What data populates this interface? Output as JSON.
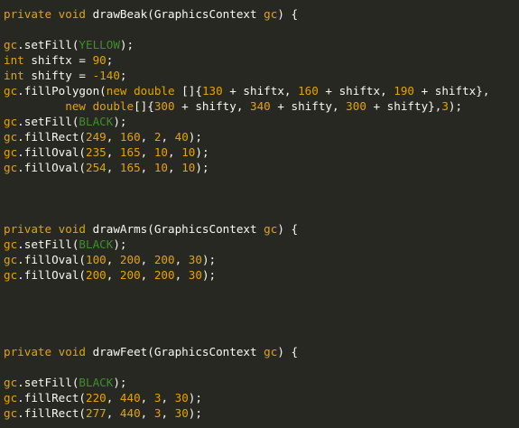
{
  "code": {
    "lines": [
      {
        "tokens": [
          [
            "kw",
            "private"
          ],
          [
            "op",
            " "
          ],
          [
            "kw",
            "void"
          ],
          [
            "op",
            " drawBeak(GraphicsContext "
          ],
          [
            "pm",
            "gc"
          ],
          [
            "op",
            ") {"
          ]
        ]
      },
      {
        "tokens": []
      },
      {
        "tokens": [
          [
            "obj",
            "gc"
          ],
          [
            "op",
            ".setFill("
          ],
          [
            "col",
            "YELLOW"
          ],
          [
            "op",
            ");"
          ]
        ]
      },
      {
        "tokens": [
          [
            "kw",
            "int"
          ],
          [
            "op",
            " shiftx = "
          ],
          [
            "num",
            "90"
          ],
          [
            "op",
            ";"
          ]
        ]
      },
      {
        "tokens": [
          [
            "kw",
            "int"
          ],
          [
            "op",
            " shifty = "
          ],
          [
            "num",
            "-140"
          ],
          [
            "op",
            ";"
          ]
        ]
      },
      {
        "tokens": [
          [
            "obj",
            "gc"
          ],
          [
            "op",
            ".fillPolygon("
          ],
          [
            "kw",
            "new"
          ],
          [
            "op",
            " "
          ],
          [
            "kw",
            "double"
          ],
          [
            "op",
            " []{"
          ],
          [
            "num",
            "130"
          ],
          [
            "op",
            " + shiftx, "
          ],
          [
            "num",
            "160"
          ],
          [
            "op",
            " + shiftx, "
          ],
          [
            "num",
            "190"
          ],
          [
            "op",
            " + shiftx},"
          ]
        ]
      },
      {
        "tokens": [
          [
            "op",
            "         "
          ],
          [
            "kw",
            "new"
          ],
          [
            "op",
            " "
          ],
          [
            "kw",
            "double"
          ],
          [
            "op",
            "[]{"
          ],
          [
            "num",
            "300"
          ],
          [
            "op",
            " + shifty, "
          ],
          [
            "num",
            "340"
          ],
          [
            "op",
            " + shifty, "
          ],
          [
            "num",
            "300"
          ],
          [
            "op",
            " + shifty},"
          ],
          [
            "num",
            "3"
          ],
          [
            "op",
            ");"
          ]
        ]
      },
      {
        "tokens": [
          [
            "obj",
            "gc"
          ],
          [
            "op",
            ".setFill("
          ],
          [
            "col",
            "BLACK"
          ],
          [
            "op",
            ");"
          ]
        ]
      },
      {
        "tokens": [
          [
            "obj",
            "gc"
          ],
          [
            "op",
            ".fillRect("
          ],
          [
            "num",
            "249"
          ],
          [
            "op",
            ", "
          ],
          [
            "num",
            "160"
          ],
          [
            "op",
            ", "
          ],
          [
            "num",
            "2"
          ],
          [
            "op",
            ", "
          ],
          [
            "num",
            "40"
          ],
          [
            "op",
            ");"
          ]
        ]
      },
      {
        "tokens": [
          [
            "obj",
            "gc"
          ],
          [
            "op",
            ".fillOval("
          ],
          [
            "num",
            "235"
          ],
          [
            "op",
            ", "
          ],
          [
            "num",
            "165"
          ],
          [
            "op",
            ", "
          ],
          [
            "num",
            "10"
          ],
          [
            "op",
            ", "
          ],
          [
            "num",
            "10"
          ],
          [
            "op",
            ");"
          ]
        ]
      },
      {
        "tokens": [
          [
            "obj",
            "gc"
          ],
          [
            "op",
            ".fillOval("
          ],
          [
            "num",
            "254"
          ],
          [
            "op",
            ", "
          ],
          [
            "num",
            "165"
          ],
          [
            "op",
            ", "
          ],
          [
            "num",
            "10"
          ],
          [
            "op",
            ", "
          ],
          [
            "num",
            "10"
          ],
          [
            "op",
            ");"
          ]
        ]
      },
      {
        "tokens": []
      },
      {
        "tokens": []
      },
      {
        "tokens": []
      },
      {
        "tokens": [
          [
            "kw",
            "private"
          ],
          [
            "op",
            " "
          ],
          [
            "kw",
            "void"
          ],
          [
            "op",
            " drawArms(GraphicsContext "
          ],
          [
            "pm",
            "gc"
          ],
          [
            "op",
            ") {"
          ]
        ]
      },
      {
        "tokens": [
          [
            "obj",
            "gc"
          ],
          [
            "op",
            ".setFill("
          ],
          [
            "col",
            "BLACK"
          ],
          [
            "op",
            ");"
          ]
        ]
      },
      {
        "tokens": [
          [
            "obj",
            "gc"
          ],
          [
            "op",
            ".fillOval("
          ],
          [
            "num",
            "100"
          ],
          [
            "op",
            ", "
          ],
          [
            "num",
            "200"
          ],
          [
            "op",
            ", "
          ],
          [
            "num",
            "200"
          ],
          [
            "op",
            ", "
          ],
          [
            "num",
            "30"
          ],
          [
            "op",
            ");"
          ]
        ]
      },
      {
        "tokens": [
          [
            "obj",
            "gc"
          ],
          [
            "op",
            ".fillOval("
          ],
          [
            "num",
            "200"
          ],
          [
            "op",
            ", "
          ],
          [
            "num",
            "200"
          ],
          [
            "op",
            ", "
          ],
          [
            "num",
            "200"
          ],
          [
            "op",
            ", "
          ],
          [
            "num",
            "30"
          ],
          [
            "op",
            ");"
          ]
        ]
      },
      {
        "tokens": []
      },
      {
        "tokens": []
      },
      {
        "tokens": []
      },
      {
        "tokens": []
      },
      {
        "tokens": [
          [
            "kw",
            "private"
          ],
          [
            "op",
            " "
          ],
          [
            "kw",
            "void"
          ],
          [
            "op",
            " drawFeet(GraphicsContext "
          ],
          [
            "pm",
            "gc"
          ],
          [
            "op",
            ") {"
          ]
        ]
      },
      {
        "tokens": []
      },
      {
        "tokens": [
          [
            "obj",
            "gc"
          ],
          [
            "op",
            ".setFill("
          ],
          [
            "col",
            "BLACK"
          ],
          [
            "op",
            ");"
          ]
        ]
      },
      {
        "tokens": [
          [
            "obj",
            "gc"
          ],
          [
            "op",
            ".fillRect("
          ],
          [
            "num",
            "220"
          ],
          [
            "op",
            ", "
          ],
          [
            "num",
            "440"
          ],
          [
            "op",
            ", "
          ],
          [
            "num",
            "3"
          ],
          [
            "op",
            ", "
          ],
          [
            "num",
            "30"
          ],
          [
            "op",
            ");"
          ]
        ]
      },
      {
        "tokens": [
          [
            "obj",
            "gc"
          ],
          [
            "op",
            ".fillRect("
          ],
          [
            "num",
            "277"
          ],
          [
            "op",
            ", "
          ],
          [
            "num",
            "440"
          ],
          [
            "op",
            ", "
          ],
          [
            "num",
            "3"
          ],
          [
            "op",
            ", "
          ],
          [
            "num",
            "30"
          ],
          [
            "op",
            ");"
          ]
        ]
      }
    ]
  }
}
